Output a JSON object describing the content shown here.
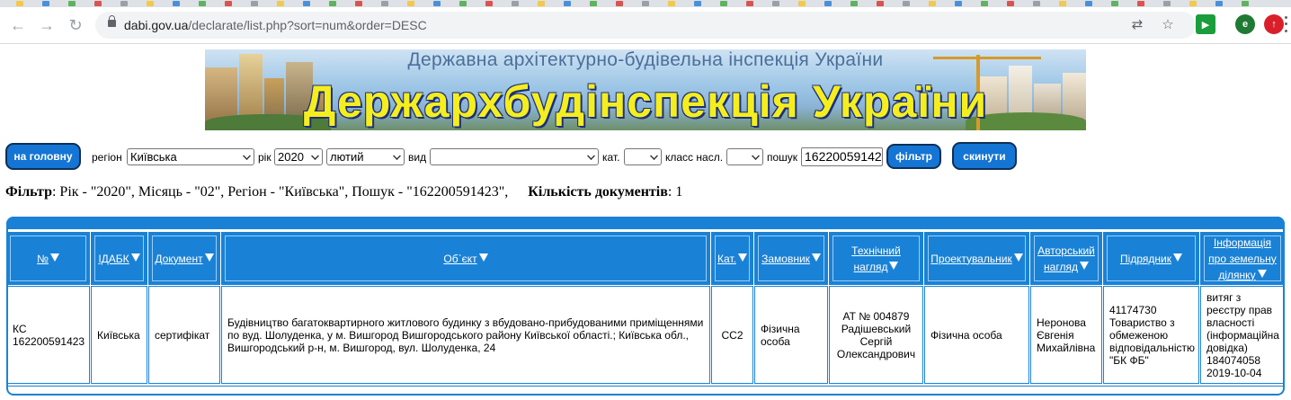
{
  "browser": {
    "url_host": "dabi.gov.ua",
    "url_path": "/declarate/list.php?sort=num&order=DESC",
    "ext_profile_letter": "e"
  },
  "banner": {
    "subtitle": "Державна архітектурно-будівельна інспекція України",
    "title": "Держархбудінспекція України"
  },
  "form": {
    "home_button": "на головну",
    "region_label": "регіон",
    "region_value": "Київська",
    "year_label": "рік",
    "year_value": "2020",
    "month_value": "лютий",
    "type_label": "вид",
    "type_value": "",
    "cat_label": "кат.",
    "cat_value": "",
    "class_label": "класс насл.",
    "class_value": "",
    "search_label": "пошук",
    "search_value": "16220059142",
    "filter_button": "фільтр",
    "reset_button": "скинути"
  },
  "filter_summary": {
    "filter_label": "Фільтр",
    "filter_text": ": Рік - \"2020\", Місяць - \"02\", Регіон - \"Київська\", Пошук - \"162200591423\",",
    "count_label": "Кількість документів",
    "count_text": ": 1"
  },
  "table": {
    "headers": [
      {
        "lines": [
          "№"
        ]
      },
      {
        "lines": [
          "ІДАБК"
        ]
      },
      {
        "lines": [
          "Документ"
        ]
      },
      {
        "lines": [
          "Об`єкт"
        ]
      },
      {
        "lines": [
          "Кат."
        ]
      },
      {
        "lines": [
          "Замовник"
        ]
      },
      {
        "lines": [
          "Технічний",
          "нагляд"
        ]
      },
      {
        "lines": [
          "Проектувальник"
        ]
      },
      {
        "lines": [
          "Авторський",
          "нагляд"
        ]
      },
      {
        "lines": [
          "Підрядник"
        ]
      },
      {
        "lines": [
          "Інформація",
          "про земельну",
          "ділянку"
        ]
      }
    ],
    "rows": [
      {
        "num": "КС 162200591423",
        "idabk": "Київська",
        "document": "сертифікат",
        "object": "Будівництво багатоквартирного житлового будинку з вбудовано-прибудованими приміщеннями по вуд. Шолуденка, у м. Вишгород Вишгородського району Київської області.; Київська обл., Вишгородський р-н, м. Вишгород, вул. Шолуденка, 24",
        "category": "СС2",
        "customer": "Фізична особа",
        "tech_supervision": "АТ № 004879 Радішевський Сергій Олександрович",
        "designer": "Фізична особа",
        "author_supervision": "Неронова Євгенія Михайлівна",
        "contractor": "41174730 Товариство з обмеженою відповідальністю \"БК ФБ\"",
        "land_info": "витяг з реєстру прав власності (інформаційна довідка) 184074058 2019-10-04"
      }
    ]
  }
}
